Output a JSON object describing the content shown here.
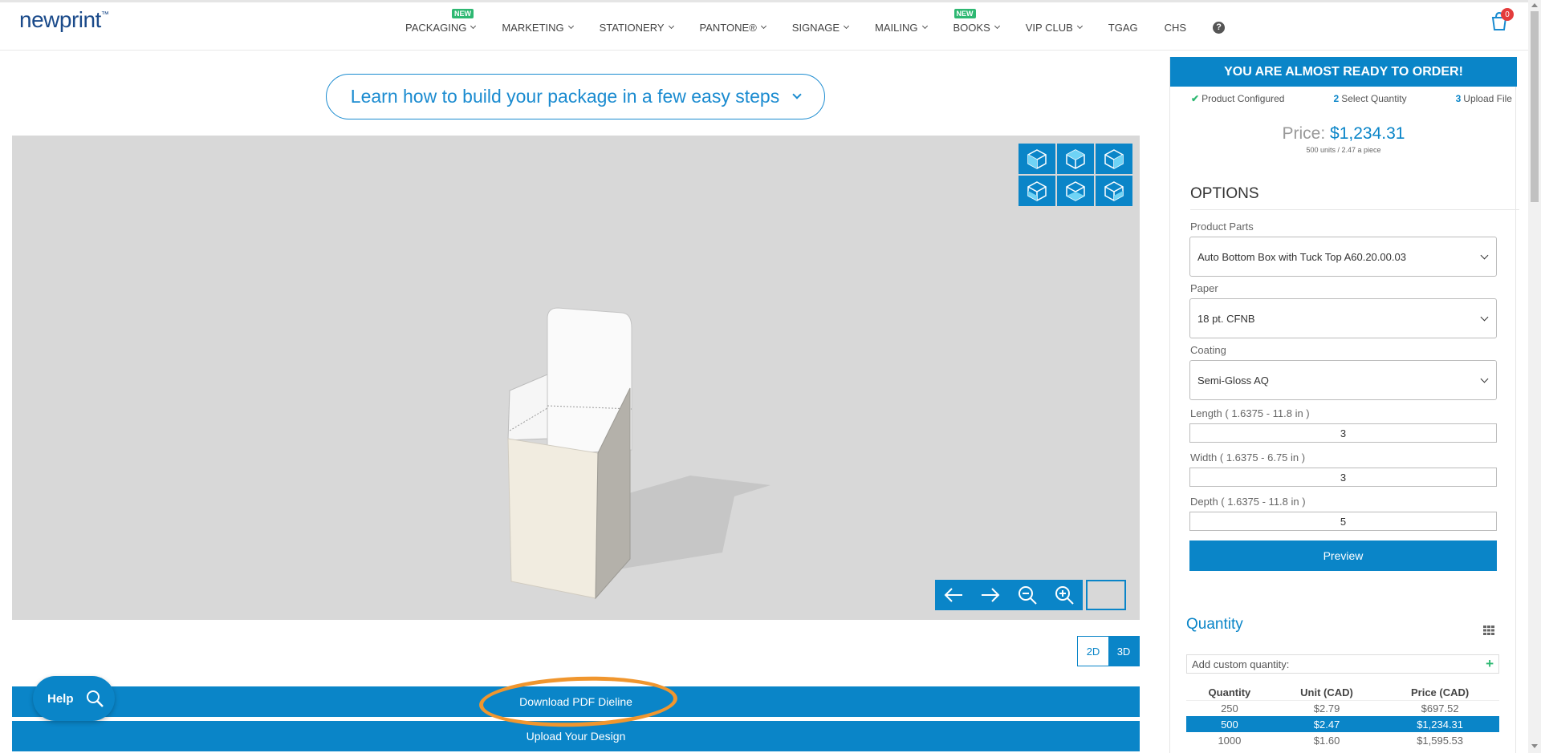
{
  "logo": {
    "text": "newprint",
    "tm": "™"
  },
  "nav": {
    "items": [
      {
        "label": "PACKAGING",
        "dropdown": true,
        "new": true
      },
      {
        "label": "MARKETING",
        "dropdown": true,
        "new": false
      },
      {
        "label": "STATIONERY",
        "dropdown": true,
        "new": false
      },
      {
        "label": "PANTONE®",
        "dropdown": true,
        "new": false
      },
      {
        "label": "SIGNAGE",
        "dropdown": true,
        "new": false
      },
      {
        "label": "MAILING",
        "dropdown": true,
        "new": false
      },
      {
        "label": "BOOKS",
        "dropdown": true,
        "new": true
      },
      {
        "label": "VIP CLUB",
        "dropdown": true,
        "new": false
      },
      {
        "label": "TGAG",
        "dropdown": false,
        "new": false
      },
      {
        "label": "CHS",
        "dropdown": false,
        "new": false
      }
    ],
    "new_badge": "NEW",
    "help_glyph": "?",
    "cart_count": "0"
  },
  "learn_banner": "Learn how to build your package in a few easy steps",
  "viewer": {
    "view_icons": [
      "cube-view-1-icon",
      "cube-view-2-icon",
      "cube-view-3-icon",
      "cube-view-4-icon",
      "cube-view-5-icon",
      "cube-view-6-icon"
    ],
    "controls": [
      "rotate-left-icon",
      "rotate-right-icon",
      "zoom-out-icon",
      "zoom-in-icon"
    ]
  },
  "toggle": {
    "two_d": "2D",
    "three_d": "3D",
    "active": "3D"
  },
  "actions": {
    "download": "Download PDF Dieline",
    "upload": "Upload Your Design"
  },
  "help_button": "Help",
  "panel": {
    "ready_title": "YOU ARE ALMOST READY TO ORDER!",
    "steps": [
      {
        "num": "",
        "label": "Product Configured",
        "done": true
      },
      {
        "num": "2",
        "label": "Select Quantity",
        "done": false
      },
      {
        "num": "3",
        "label": "Upload File",
        "done": false
      }
    ],
    "price_label": "Price: ",
    "price_value": "$1,234.31",
    "price_sub": "500 units / 2.47 a piece",
    "options_title": "OPTIONS",
    "product_parts": {
      "label": "Product Parts",
      "value": "Auto Bottom Box with Tuck Top A60.20.00.03"
    },
    "paper": {
      "label": "Paper",
      "value": "18 pt. CFNB"
    },
    "coating": {
      "label": "Coating",
      "value": "Semi-Gloss AQ"
    },
    "length": {
      "label": "Length ( 1.6375 - 11.8 in )",
      "value": "3"
    },
    "width": {
      "label": "Width ( 1.6375 - 6.75 in )",
      "value": "3"
    },
    "depth": {
      "label": "Depth ( 1.6375 - 11.8 in )",
      "value": "5"
    },
    "preview_label": "Preview",
    "quantity_title": "Quantity",
    "custom_quantity_placeholder": "Add custom quantity:",
    "table": {
      "headers": [
        "Quantity",
        "Unit (CAD)",
        "Price (CAD)"
      ],
      "rows": [
        {
          "qty": "250",
          "unit": "$2.79",
          "price": "$697.52",
          "selected": false
        },
        {
          "qty": "500",
          "unit": "$2.47",
          "price": "$1,234.31",
          "selected": true
        },
        {
          "qty": "1000",
          "unit": "$1.60",
          "price": "$1,595.53",
          "selected": false
        }
      ]
    }
  },
  "colors": {
    "accent": "#0a85c8",
    "highlight": "#f0962e",
    "new_badge": "#2eb872",
    "cart_badge": "#e43c3c"
  }
}
